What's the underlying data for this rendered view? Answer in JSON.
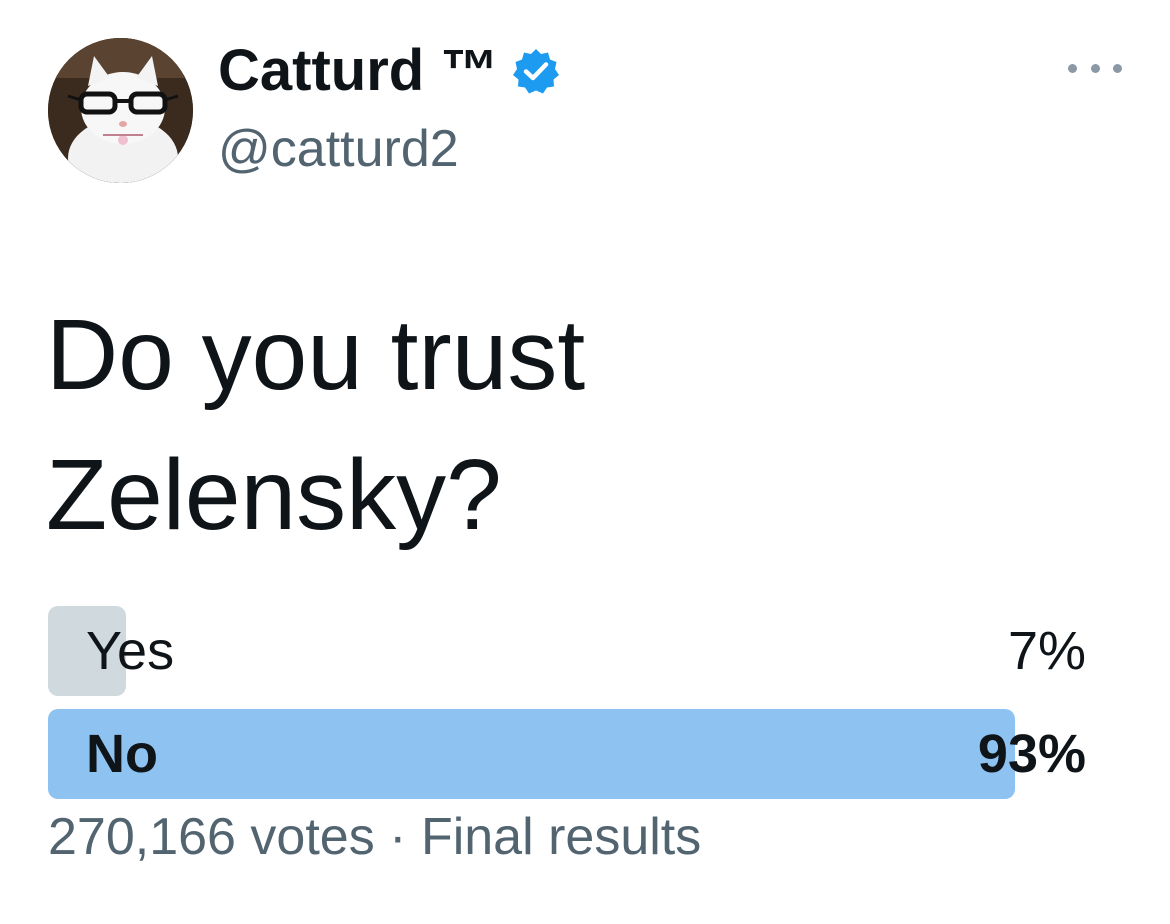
{
  "author": {
    "display_name": "Catturd ™",
    "handle": "@catturd2",
    "verified": true,
    "verified_color": "#1d9bf0"
  },
  "tweet": {
    "text": "Do you trust\nZelensky?"
  },
  "poll": {
    "options": [
      {
        "label": "Yes",
        "percent_text": "7%",
        "percent": 7,
        "winner": false,
        "bar_color": "#cfd9de"
      },
      {
        "label": "No",
        "percent_text": "93%",
        "percent": 93,
        "winner": true,
        "bar_color": "#8ec2f1"
      }
    ],
    "votes": "270,166 votes",
    "separator": "·",
    "status": "Final results"
  },
  "icons": {
    "more": "more-horizontal-icon",
    "verified": "verified-badge-icon",
    "avatar": "cat-with-glasses-avatar"
  }
}
